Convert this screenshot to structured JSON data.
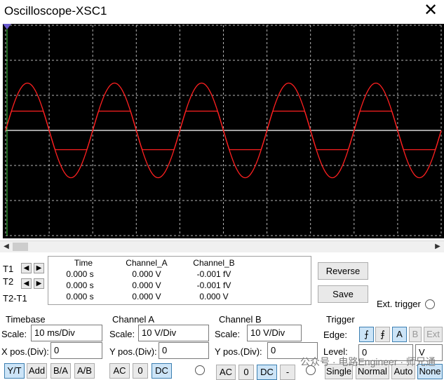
{
  "window": {
    "title": "Oscilloscope-XSC1",
    "close_glyph": "✕"
  },
  "cursors": {
    "t1": "T1",
    "t2": "T2",
    "t2t1": "T2-T1"
  },
  "readout": {
    "headers": {
      "time": "Time",
      "channel_a": "Channel_A",
      "channel_b": "Channel_B"
    },
    "rows": [
      {
        "time": "0.000 s",
        "a": "0.000 V",
        "b": "-0.001 fV"
      },
      {
        "time": "0.000 s",
        "a": "0.000 V",
        "b": "-0.001 fV"
      },
      {
        "time": "0.000 s",
        "a": "0.000 V",
        "b": "0.000 V"
      }
    ]
  },
  "buttons": {
    "reverse": "Reverse",
    "save": "Save",
    "ext_trigger": "Ext. trigger"
  },
  "timebase": {
    "title": "Timebase",
    "scale_label": "Scale:",
    "scale_value": "10 ms/Div",
    "xpos_label": "X pos.(Div):",
    "xpos_value": "0",
    "modes": [
      "Y/T",
      "Add",
      "B/A",
      "A/B"
    ],
    "selected_mode": "Y/T"
  },
  "channel_a": {
    "title": "Channel A",
    "scale_label": "Scale:",
    "scale_value": "10  V/Div",
    "ypos_label": "Y pos.(Div):",
    "ypos_value": "0",
    "coupling": [
      "AC",
      "0",
      "DC"
    ],
    "selected": "DC"
  },
  "channel_b": {
    "title": "Channel B",
    "scale_label": "Scale:",
    "scale_value": "10  V/Div",
    "ypos_label": "Y pos.(Div):",
    "ypos_value": "0",
    "coupling": [
      "AC",
      "0",
      "DC",
      "-"
    ],
    "selected": "DC"
  },
  "trigger": {
    "title": "Trigger",
    "edge_label": "Edge:",
    "level_label": "Level:",
    "level_value": "0",
    "level_unit": "V",
    "sources": [
      "A",
      "B",
      "Ext"
    ],
    "selected_source": "A",
    "modes": [
      "Single",
      "Normal",
      "Auto",
      "None"
    ],
    "selected_mode": "None",
    "rising_icon": "rising-edge",
    "falling_icon": "falling-edge"
  },
  "watermark": "公众号 · 电路Engineer · 师兄通",
  "colors": {
    "screen_bg": "#000000",
    "trace": "#ff2020",
    "grid": "#ffffff",
    "selected": "#cce4f7"
  },
  "chart_data": {
    "type": "line",
    "x_divisions": 10,
    "y_divisions": 6,
    "series": [
      {
        "amplitude_div": 1.35,
        "cycles_on_screen": 5,
        "clipped_at_div": null
      },
      {
        "amplitude_div": 1.35,
        "cycles_on_screen": 5,
        "clipped_at_div": 0.55
      }
    ]
  }
}
